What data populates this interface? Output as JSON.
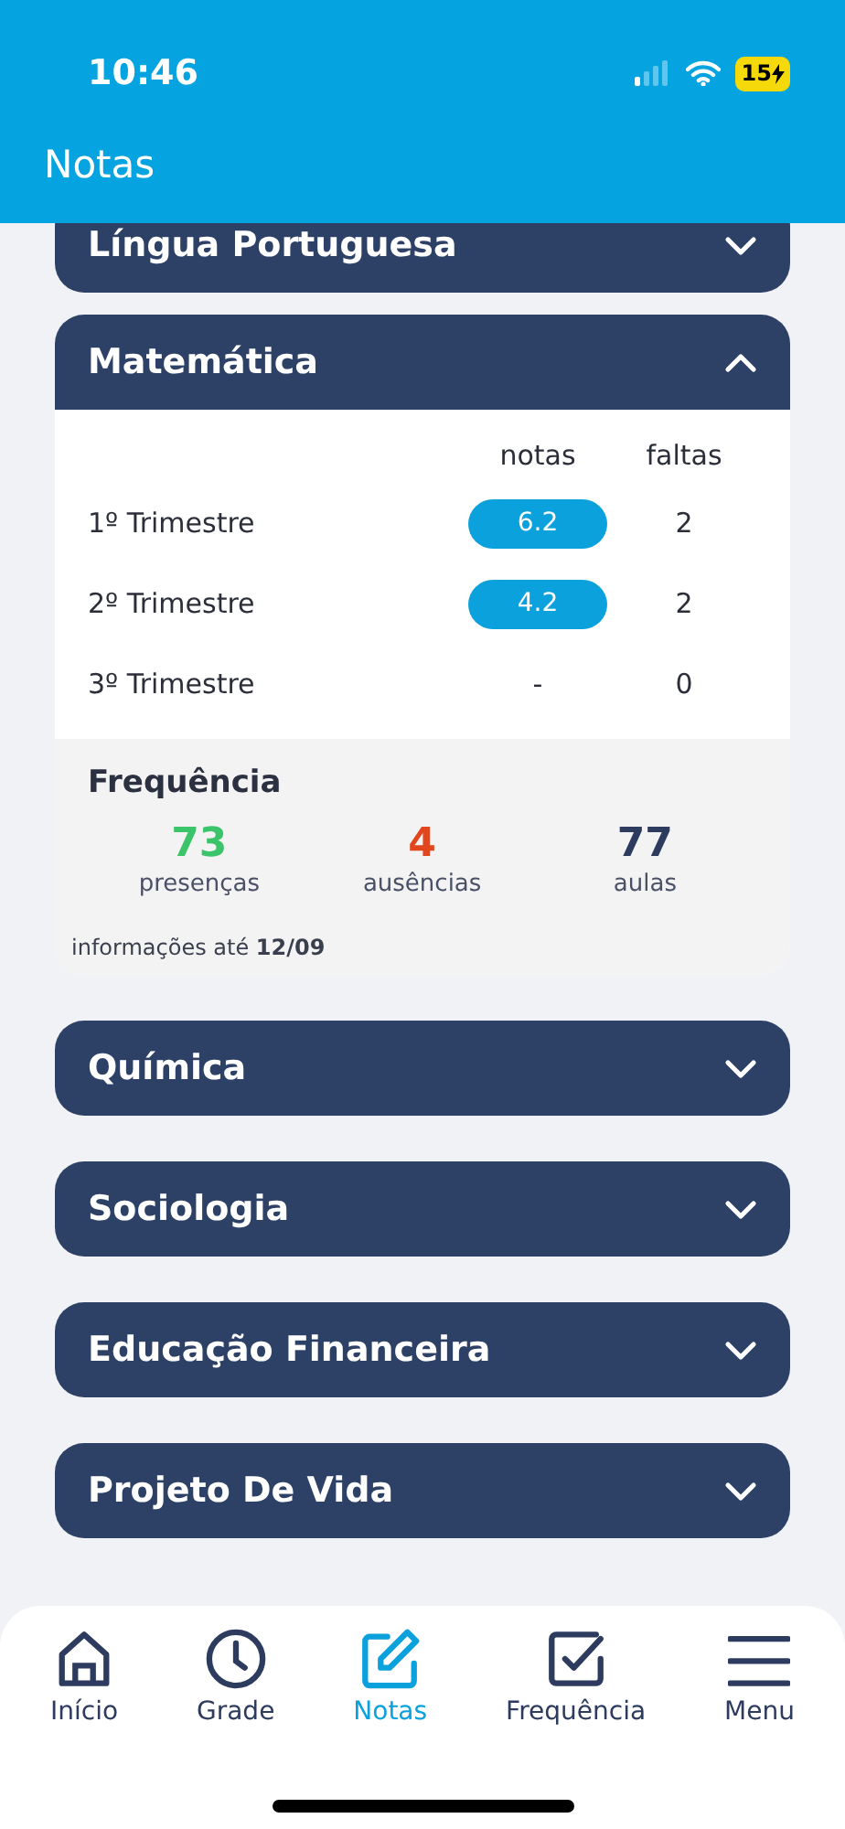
{
  "status_bar": {
    "time": "10:46",
    "battery": "15"
  },
  "header": {
    "title": "Notas"
  },
  "subjects": [
    {
      "name": "Língua Portuguesa",
      "expanded": false
    },
    {
      "name": "Matemática",
      "expanded": true,
      "columns": [
        "notas",
        "faltas"
      ],
      "rows": [
        {
          "period": "1º Trimestre",
          "kind": "badge",
          "grade": "6.2",
          "absences": "2"
        },
        {
          "period": "2º Trimestre",
          "kind": "badge",
          "grade": "4.2",
          "absences": "2"
        },
        {
          "period": "3º Trimestre",
          "kind": "plain",
          "grade": "-",
          "absences": "0"
        }
      ],
      "frequency": {
        "title": "Frequência",
        "stats": [
          {
            "value": "73",
            "label": "presenças",
            "color": "#3cc46a"
          },
          {
            "value": "4",
            "label": "ausências",
            "color": "#e2461c"
          },
          {
            "value": "77",
            "label": "aulas",
            "color": "#2d3c5e"
          }
        ]
      },
      "updated": "informações até **12/09**"
    },
    {
      "name": "Química",
      "expanded": false
    },
    {
      "name": "Sociologia",
      "expanded": false
    },
    {
      "name": "Educação Financeira",
      "expanded": false
    },
    {
      "name": "Projeto De Vida",
      "expanded": false
    }
  ],
  "nav": [
    {
      "label": "Início",
      "kind": "home",
      "selected": false
    },
    {
      "label": "Grade",
      "kind": "clock",
      "selected": false
    },
    {
      "label": "Notas",
      "kind": "edit",
      "selected": true
    },
    {
      "label": "Frequência",
      "kind": "check",
      "selected": false
    },
    {
      "label": "Menu",
      "kind": "menu",
      "selected": false
    }
  ]
}
